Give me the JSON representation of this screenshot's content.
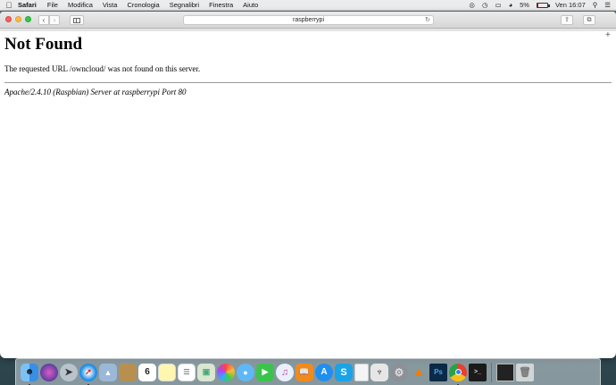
{
  "menubar": {
    "app_name": "Safari",
    "items": [
      "File",
      "Modifica",
      "Vista",
      "Cronologia",
      "Segnalibri",
      "Finestra",
      "Aiuto"
    ],
    "battery_text": "5%",
    "battery_level": 0.05,
    "clock": "Ven 16:07",
    "status_icons": [
      "creative-cloud-icon",
      "time-machine-icon",
      "airplay-icon",
      "wifi-icon",
      "battery-icon",
      "spotlight-icon",
      "notification-center-icon"
    ]
  },
  "browser": {
    "address": "raspberrypi",
    "buttons": [
      "back-icon",
      "forward-icon",
      "sidebar-icon",
      "reload-icon",
      "share-icon",
      "tabs-icon",
      "new-tab-icon"
    ]
  },
  "page": {
    "heading": "Not Found",
    "message": "The requested URL /owncloud/ was not found on this server.",
    "signature": "Apache/2.4.10 (Raspbian) Server at raspberrypi Port 80"
  },
  "dock": {
    "calendar_day": "6",
    "app_icons": [
      "finder-icon",
      "siri-icon",
      "launchpad-icon",
      "safari-icon",
      "photo-icon",
      "notes-icon",
      "calendar-icon",
      "stickies-icon",
      "reminders-icon",
      "preview-icon",
      "photos-icon",
      "messages-icon",
      "facetime-icon",
      "itunes-icon",
      "ibooks-icon",
      "app-store-icon",
      "skype-icon",
      "textedit-icon",
      "microphone-icon",
      "system-preferences-icon",
      "vlc-icon",
      "photoshop-icon",
      "chrome-icon",
      "terminal-icon",
      "document-icon",
      "trash-icon"
    ],
    "colors": {
      "finder": "#3a8ee6",
      "siri": "#5b3f9e",
      "safari": "#1f8fe8",
      "photoshop": "#0c2a46",
      "chrome": "#e5412f",
      "vlc": "#f07d00"
    }
  }
}
